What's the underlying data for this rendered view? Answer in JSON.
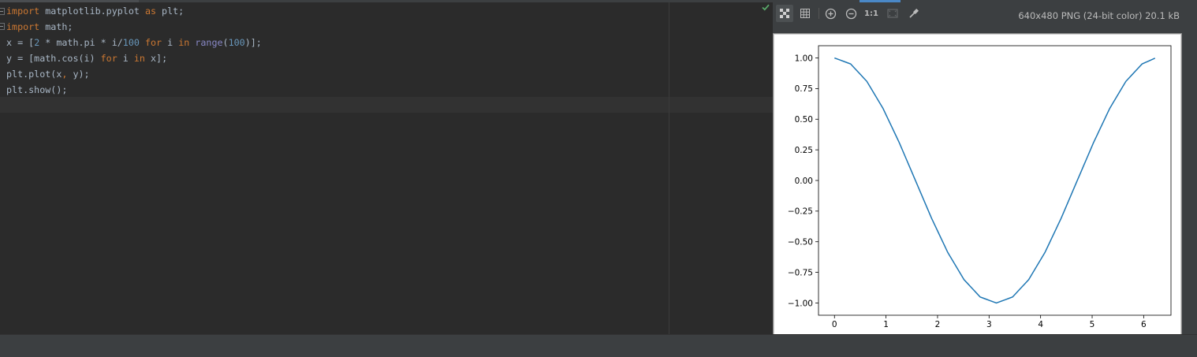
{
  "editor": {
    "lines": [
      [
        {
          "t": "import",
          "c": "kw"
        },
        {
          "t": " matplotlib.pyplot ",
          "c": "pl"
        },
        {
          "t": "as",
          "c": "kw"
        },
        {
          "t": " plt;",
          "c": "pl"
        }
      ],
      [
        {
          "t": "import",
          "c": "kw"
        },
        {
          "t": " math;",
          "c": "pl"
        }
      ],
      [
        {
          "t": "x = [",
          "c": "pl"
        },
        {
          "t": "2",
          "c": "num"
        },
        {
          "t": " * math.pi * i/",
          "c": "pl"
        },
        {
          "t": "100",
          "c": "num"
        },
        {
          "t": " ",
          "c": "pl"
        },
        {
          "t": "for",
          "c": "kw"
        },
        {
          "t": " i ",
          "c": "pl"
        },
        {
          "t": "in",
          "c": "kw"
        },
        {
          "t": " ",
          "c": "pl"
        },
        {
          "t": "range",
          "c": "bi"
        },
        {
          "t": "(",
          "c": "pl"
        },
        {
          "t": "100",
          "c": "num"
        },
        {
          "t": ")];",
          "c": "pl"
        }
      ],
      [
        {
          "t": "y = [math.cos(i) ",
          "c": "pl"
        },
        {
          "t": "for",
          "c": "kw"
        },
        {
          "t": " i ",
          "c": "pl"
        },
        {
          "t": "in",
          "c": "kw"
        },
        {
          "t": " x];",
          "c": "pl"
        }
      ],
      [
        {
          "t": "plt.plot(x",
          "c": "pl"
        },
        {
          "t": ",",
          "c": "kw"
        },
        {
          "t": " y);",
          "c": "pl"
        }
      ],
      [
        {
          "t": "plt.show();",
          "c": "pl"
        }
      ]
    ]
  },
  "viewer": {
    "image_info": "640x480 PNG (24-bit color) 20.1 kB",
    "zoom_actual_label": "1:1",
    "toolbar_icons": [
      "chessboard-icon",
      "grid-icon",
      "zoom-in-icon",
      "zoom-out-icon",
      "actual-size-icon",
      "fit-icon",
      "color-picker-icon"
    ]
  },
  "colors": {
    "keyword": "#cc7832",
    "number": "#6897bb",
    "builtin": "#8888c6",
    "plain": "#a9b7c6",
    "line_series": "#1f77b4",
    "check": "#59a869"
  },
  "chart_data": {
    "type": "line",
    "title": "",
    "xlabel": "",
    "ylabel": "",
    "xlim": [
      -0.31,
      6.53
    ],
    "ylim": [
      -1.1,
      1.1
    ],
    "xticks": [
      0,
      1,
      2,
      3,
      4,
      5,
      6
    ],
    "xtick_labels": [
      "0",
      "1",
      "2",
      "3",
      "4",
      "5",
      "6"
    ],
    "yticks": [
      1.0,
      0.75,
      0.5,
      0.25,
      0.0,
      -0.25,
      -0.5,
      -0.75,
      -1.0
    ],
    "ytick_labels": [
      "1.00",
      "0.75",
      "0.50",
      "0.25",
      "0.00",
      "−0.25",
      "−0.50",
      "−0.75",
      "−1.00"
    ],
    "grid": false,
    "series": [
      {
        "x": [
          0,
          0.314,
          0.628,
          0.942,
          1.257,
          1.571,
          1.885,
          2.199,
          2.513,
          2.827,
          3.142,
          3.456,
          3.77,
          4.084,
          4.398,
          4.712,
          5.027,
          5.341,
          5.655,
          5.969,
          6.22
        ],
        "y": [
          1.0,
          0.951,
          0.809,
          0.588,
          0.309,
          0.0,
          -0.309,
          -0.588,
          -0.809,
          -0.951,
          -1.0,
          -0.951,
          -0.809,
          -0.588,
          -0.309,
          0.0,
          0.309,
          0.588,
          0.809,
          0.951,
          0.998
        ]
      }
    ]
  }
}
